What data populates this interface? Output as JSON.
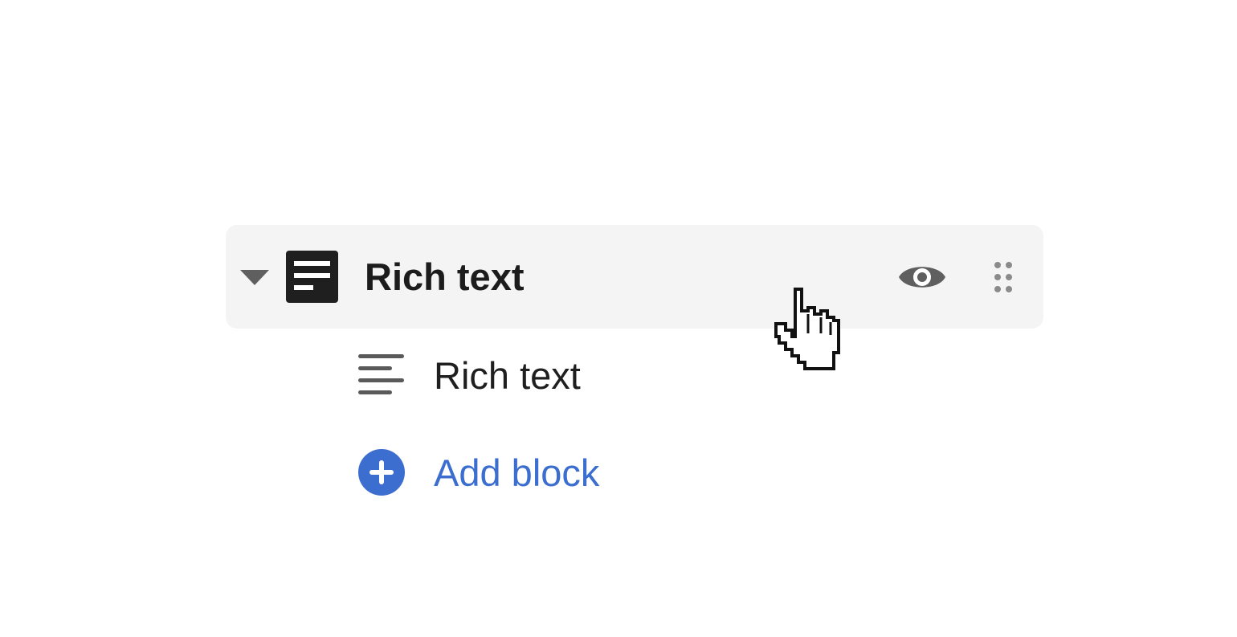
{
  "section": {
    "title": "Rich text",
    "icons": {
      "toggle": "caret-down-icon",
      "type": "rich-text-section-icon",
      "visibility": "eye-icon",
      "drag": "drag-handle-icon"
    }
  },
  "block": {
    "label": "Rich text",
    "icon": "text-align-left-icon"
  },
  "add_block": {
    "label": "Add block",
    "icon": "plus-circle-icon"
  },
  "pointer": {
    "icon": "hand-pointer-cursor"
  },
  "colors": {
    "row_background": "#f4f4f4",
    "text": "#1c1c1c",
    "icon_gray": "#606060",
    "link_blue": "#3c6ed0"
  }
}
